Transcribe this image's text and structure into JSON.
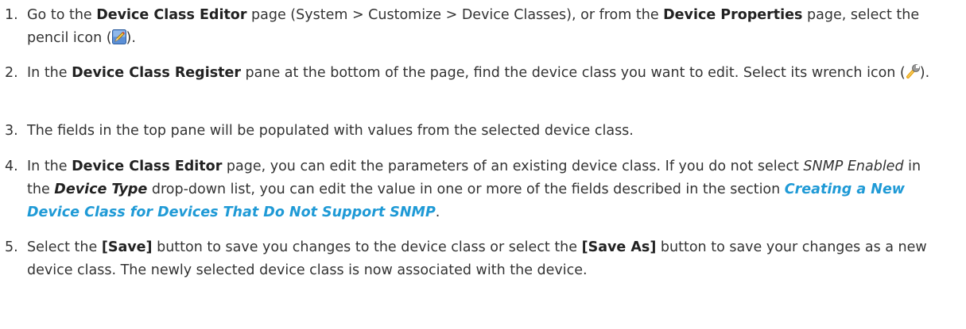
{
  "colors": {
    "text": "#333333",
    "bold": "#222222",
    "link": "#1f9ad6"
  },
  "steps": [
    {
      "number": "1.",
      "p1": "Go to the ",
      "b1": "Device Class Editor",
      "p2": " page (System > Customize > Device Classes), or from the ",
      "b2": "Device Properties",
      "p3": " page, select the pencil icon (",
      "icon": "pencil-icon",
      "p4": ")."
    },
    {
      "number": "2.",
      "p1": "In the ",
      "b1": "Device Class Register",
      "p2": " pane at the bottom of the page, find the device class you want to edit. Select its wrench icon (",
      "icon": "wrench-icon",
      "p3": ")."
    },
    {
      "number": "3.",
      "text": "The fields in the top pane will be populated with values from the selected device class."
    },
    {
      "number": "4.",
      "p1": "In the ",
      "b1": "Device Class Editor",
      "p2": " page, you can edit the parameters of an existing device class. If you do not select ",
      "i1": "SNMP Enabled",
      "p3": " in the ",
      "bi1": "Device Type",
      "p4": " drop-down list, you can edit the value in one or more of the fields described in the section ",
      "link": "Creating a New Device Class for Devices That Do Not Support SNMP",
      "p5": "."
    },
    {
      "number": "5.",
      "p1": "Select the ",
      "b1": "[Save]",
      "p2": " button to save you changes to the device class or select the ",
      "b2": "[Save As]",
      "p3": " button to save your changes as a new device class. The newly selected device class is now associated with the device."
    }
  ]
}
